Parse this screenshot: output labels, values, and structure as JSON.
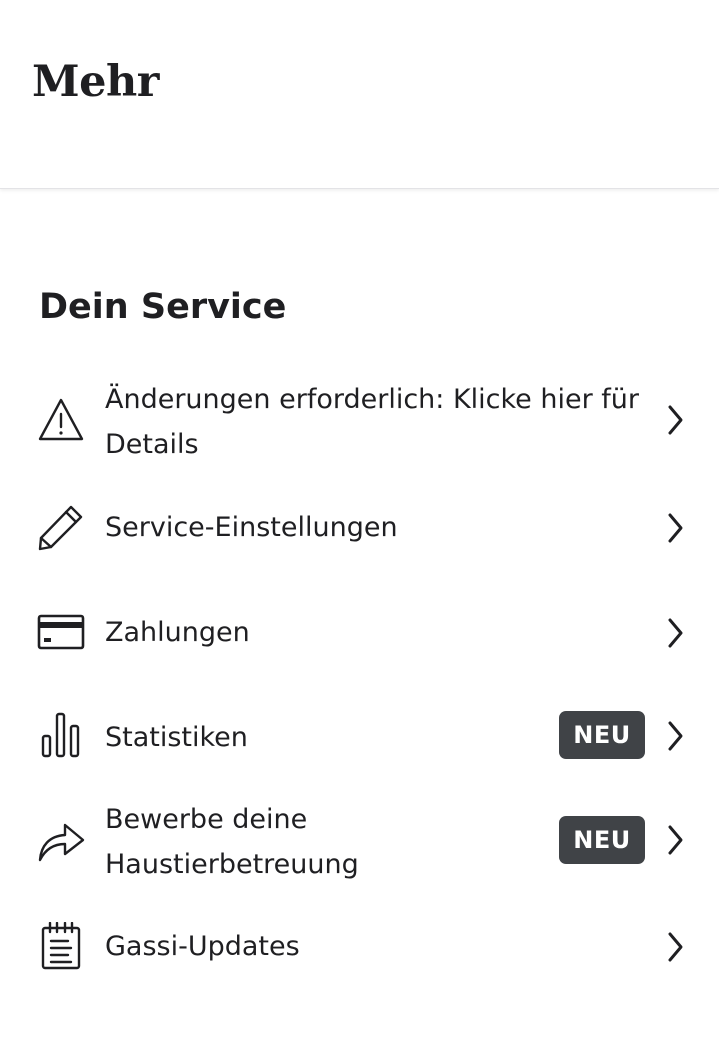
{
  "header": {
    "title": "Mehr"
  },
  "section": {
    "title": "Dein Service"
  },
  "menu": {
    "items": [
      {
        "label": "Änderungen erforderlich: Klicke hier für Details",
        "icon": "warning-icon"
      },
      {
        "label": "Service-Einstellungen",
        "icon": "pencil-icon"
      },
      {
        "label": "Zahlungen",
        "icon": "credit-card-icon"
      },
      {
        "label": "Statistiken",
        "icon": "bar-chart-icon",
        "badge": "NEU"
      },
      {
        "label": "Bewerbe deine Haustierbetreuung",
        "icon": "share-arrow-icon",
        "badge": "NEU"
      },
      {
        "label": "Gassi-Updates",
        "icon": "notepad-icon"
      }
    ]
  },
  "colors": {
    "text": "#1f1f22",
    "badge_background": "#404347",
    "badge_text": "#ffffff",
    "divider": "#e3e3e6"
  }
}
